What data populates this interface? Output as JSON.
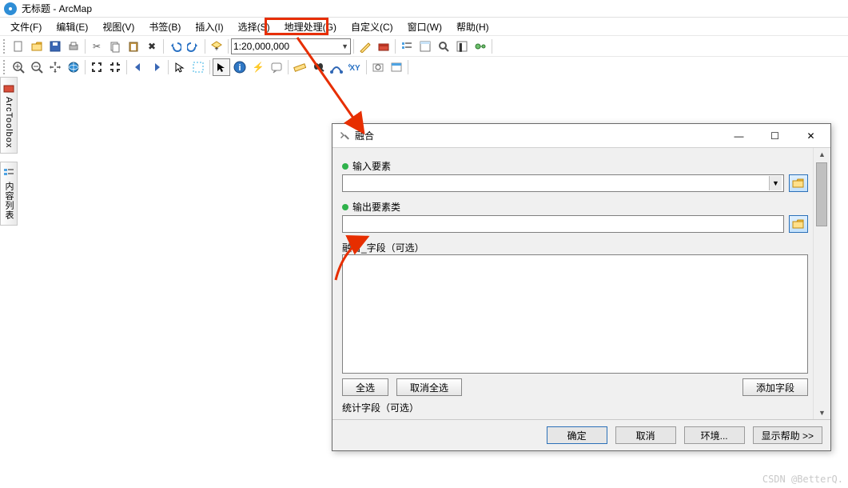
{
  "titlebar": {
    "title": "无标题 - ArcMap"
  },
  "menubar": {
    "items": [
      {
        "label": "文件(F)"
      },
      {
        "label": "编辑(E)"
      },
      {
        "label": "视图(V)"
      },
      {
        "label": "书签(B)"
      },
      {
        "label": "插入(I)"
      },
      {
        "label": "选择(S)"
      },
      {
        "label": "地理处理(G)",
        "highlight": true
      },
      {
        "label": "自定义(C)"
      },
      {
        "label": "窗口(W)"
      },
      {
        "label": "帮助(H)"
      }
    ]
  },
  "toolbar1": {
    "scale": "1:20,000,000"
  },
  "sidebars": {
    "arctoolbox": "ArcToolbox",
    "toc": "内容列表"
  },
  "dialog": {
    "title": "融合",
    "input_features": "输入要素",
    "output_fc": "输出要素类",
    "dissolve_fields": "融合_字段（可选）",
    "select_all": "全选",
    "unselect_all": "取消全选",
    "add_field": "添加字段",
    "stat_fields": "统计字段（可选）",
    "ok": "确定",
    "cancel": "取消",
    "env": "环境...",
    "show_help": "显示帮助 >>"
  },
  "watermark": "CSDN @BetterQ."
}
